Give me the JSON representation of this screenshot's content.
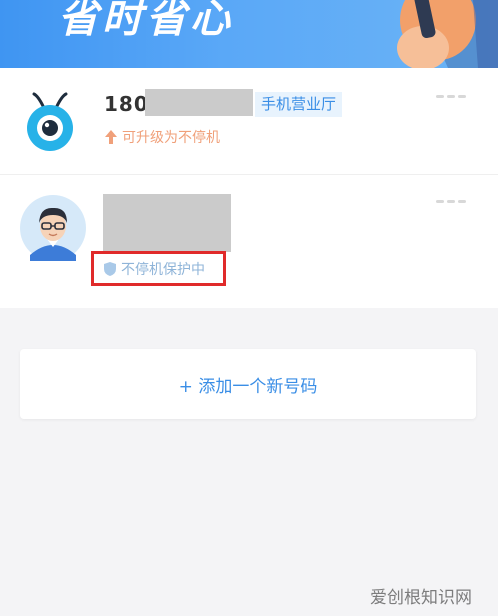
{
  "banner": {
    "slogan": "省时省心"
  },
  "accounts": [
    {
      "phone_visible": "180",
      "tag": "手机营业厅",
      "action": "可升级为不停机"
    },
    {
      "status": "不停机保护中"
    }
  ],
  "add_button": {
    "label": "+ 添加一个新号码"
  },
  "watermark": "爱创根知识网",
  "colors": {
    "brand_blue": "#3f95f2",
    "link_blue": "#3a8ee6",
    "upgrade_orange": "#f0a07a",
    "highlight_red": "#e02a2a"
  }
}
